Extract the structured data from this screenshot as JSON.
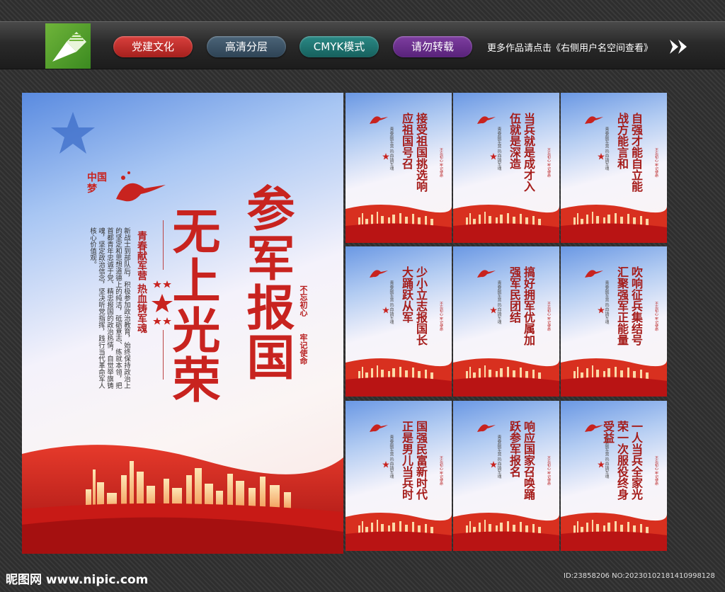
{
  "topbar": {
    "tags": [
      "党建文化",
      "高清分层",
      "CMYK模式",
      "请勿转载"
    ],
    "note": "更多作品请点击《右侧用户名空间查看》"
  },
  "main_poster": {
    "title_a": "参军报国",
    "title_b": "无上光荣",
    "slogan": "青春献军营 热血铸军魂",
    "badge_a": "不忘初心",
    "badge_b": "牢记使命",
    "body": "新战士到部队后，积极参加政治教育，始终保持政治上的坚定和思想道德上的纯洁，砥砺意志、练就本领，把首都青年忠诚于党、精忠报国的政治热情，自觉举旗铸魂，坚定政治信念，坚决听党指挥，践行当代革命军人核心价值观。",
    "logo_text": "中国梦"
  },
  "mini_posters": [
    {
      "title": "接受祖国挑选响应祖国号召"
    },
    {
      "title": "当兵就是成才入伍就是深造"
    },
    {
      "title": "自强才能自立能战方能言和"
    },
    {
      "title": "少小立志报国长大踊跃从军"
    },
    {
      "title": "搞好拥军优属加强军民团结"
    },
    {
      "title": "吹响征兵集结号汇聚强军正能量"
    },
    {
      "title": "国强民富新时代正是男儿当兵时"
    },
    {
      "title": "响应国家召唤踊跃参军报名"
    },
    {
      "title": "一人当兵全家光荣一次服役终身受益"
    }
  ],
  "mini_sub": "青春献军营 热血铸军魂",
  "mini_badge": "不忘初心 牢记使命",
  "footer": {
    "site": "昵图网 www.nipic.com",
    "id": "ID:23858206 NO:20230102181410998128"
  },
  "colors": {
    "red": "#c8231f",
    "dark_red": "#a51c1a",
    "accent_green": "#5aa52e"
  }
}
